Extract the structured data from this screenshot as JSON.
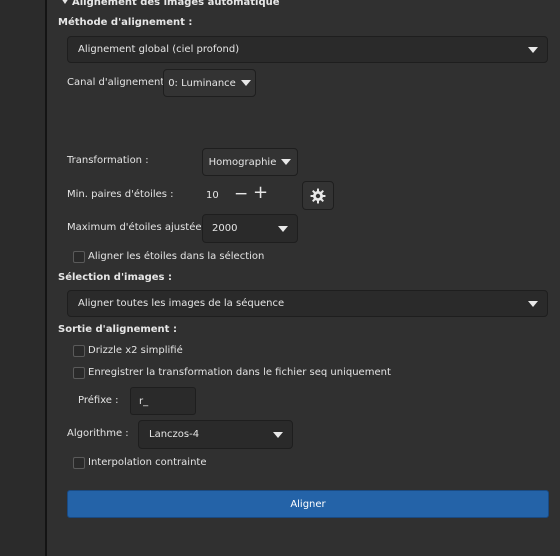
{
  "section": {
    "expander_label": "Alignement des images automatique"
  },
  "method": {
    "title": "Méthode d'alignement :",
    "selected": "Alignement global (ciel profond)",
    "channel_label": "Canal d'alignement :",
    "channel_value": "0: Luminance"
  },
  "transform": {
    "label": "Transformation :",
    "value": "Homographie"
  },
  "min_pairs": {
    "label": "Min. paires d'étoiles :",
    "value": "10",
    "minus": "−",
    "plus": "+"
  },
  "max_stars": {
    "label": "Maximum d'étoiles ajustées :",
    "value": "2000"
  },
  "align_stars_selection": {
    "label": "Aligner les étoiles dans la sélection",
    "checked": false
  },
  "selection": {
    "title": "Sélection d'images :",
    "selected": "Aligner toutes les images de la séquence"
  },
  "output": {
    "title": "Sortie d'alignement :",
    "drizzle": {
      "label": "Drizzle x2 simplifié",
      "checked": false
    },
    "save_transform": {
      "label": "Enregistrer la transformation dans le fichier seq uniquement",
      "checked": false
    },
    "prefix_label": "Préfixe :",
    "prefix_value": "r_",
    "algorithm_label": "Algorithme :",
    "algorithm_value": "Lanczos-4",
    "interpolation": {
      "label": "Interpolation contrainte",
      "checked": false
    }
  },
  "actions": {
    "align_button": "Aligner"
  },
  "colors": {
    "background": "#2b2b2b",
    "panel": "#303030",
    "primary": "#2463a8"
  }
}
